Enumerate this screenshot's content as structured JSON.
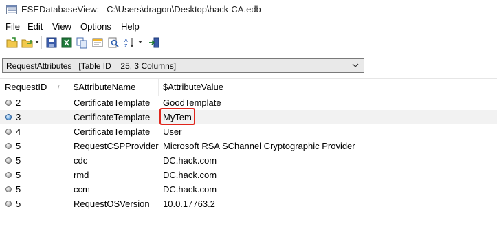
{
  "window": {
    "app_name": "ESEDatabaseView:",
    "file_path": "C:\\Users\\dragon\\Desktop\\hack-CA.edb"
  },
  "menu": [
    "File",
    "Edit",
    "View",
    "Options",
    "Help"
  ],
  "toolbar": {
    "icons": [
      "open-folder-icon",
      "open-dropdown-icon",
      "save-icon",
      "excel-export-icon",
      "copy-icon",
      "properties-icon",
      "find-icon",
      "sort-az-icon",
      "exit-icon"
    ]
  },
  "table_selector": {
    "selected": "RequestAttributes   [Table ID = 25, 3 Columns]"
  },
  "columns": [
    "RequestID",
    "$AttributeName",
    "$AttributeValue"
  ],
  "sort_indicator": "/",
  "rows": [
    {
      "id": "2",
      "name": "CertificateTemplate",
      "value": "GoodTemplate",
      "icon": "gray-circle-icon"
    },
    {
      "id": "3",
      "name": "CertificateTemplate",
      "value": "MyTem",
      "icon": "globe-icon"
    },
    {
      "id": "4",
      "name": "CertificateTemplate",
      "value": "User",
      "icon": "gray-circle-icon"
    },
    {
      "id": "5",
      "name": "RequestCSPProvider",
      "value": "Microsoft RSA SChannel Cryptographic Provider",
      "icon": "gray-circle-icon"
    },
    {
      "id": "5",
      "name": "cdc",
      "value": "DC.hack.com",
      "icon": "gray-circle-icon"
    },
    {
      "id": "5",
      "name": "rmd",
      "value": "DC.hack.com",
      "icon": "gray-circle-icon"
    },
    {
      "id": "5",
      "name": "ccm",
      "value": "DC.hack.com",
      "icon": "gray-circle-icon"
    },
    {
      "id": "5",
      "name": "RequestOSVersion",
      "value": "10.0.17763.2",
      "icon": "gray-circle-icon"
    }
  ],
  "colors": {
    "highlight_border": "#e0251c",
    "selected_row": "#f2f2f2"
  }
}
